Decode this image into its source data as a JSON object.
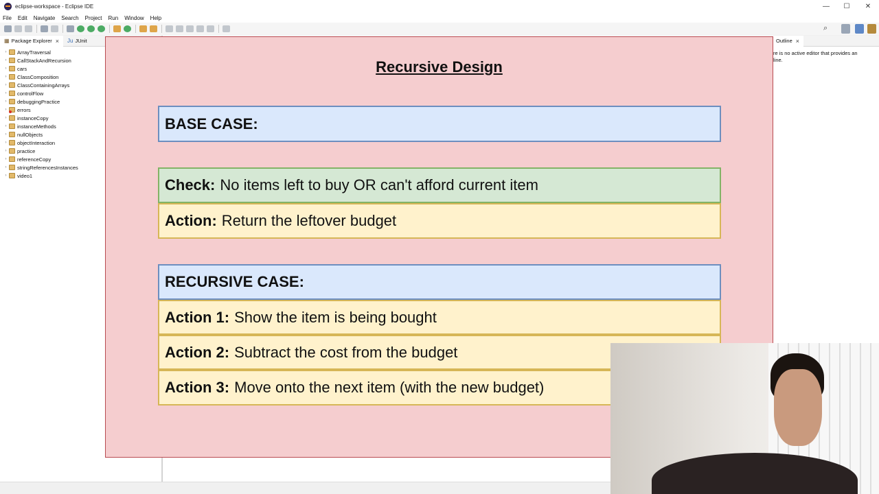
{
  "window": {
    "title": "eclipse-workspace - Eclipse IDE",
    "minimize": "—",
    "maximize": "☐",
    "close": "✕"
  },
  "menu": [
    "File",
    "Edit",
    "Navigate",
    "Search",
    "Project",
    "Run",
    "Window",
    "Help"
  ],
  "package_explorer": {
    "tab_label": "Package Explorer",
    "junit_tab_label": "JUnit",
    "projects": [
      {
        "name": "ArrayTraversal",
        "error": false
      },
      {
        "name": "CallStackAndRecursion",
        "error": false
      },
      {
        "name": "cars",
        "error": false
      },
      {
        "name": "ClassComposition",
        "error": false
      },
      {
        "name": "ClassContainingArrays",
        "error": false
      },
      {
        "name": "controlFlow",
        "error": false
      },
      {
        "name": "debuggingPractice",
        "error": false
      },
      {
        "name": "errors",
        "error": true
      },
      {
        "name": "instanceCopy",
        "error": false
      },
      {
        "name": "instanceMethods",
        "error": false
      },
      {
        "name": "nullObjects",
        "error": false
      },
      {
        "name": "objectInteraction",
        "error": false
      },
      {
        "name": "practice",
        "error": false
      },
      {
        "name": "referenceCopy",
        "error": false
      },
      {
        "name": "stringReferencesInstances",
        "error": false
      },
      {
        "name": "video1",
        "error": false
      }
    ]
  },
  "outline": {
    "tab_label": "Outline",
    "message_line1": "re is no active editor that provides an",
    "message_line2": "line."
  },
  "slide": {
    "title": "Recursive Design",
    "base_case": {
      "header": "BASE CASE:",
      "check_label": "Check:",
      "check_text": "No items left to buy OR can't afford current item",
      "action_label": "Action:",
      "action_text": "Return the leftover budget"
    },
    "recursive_case": {
      "header": "RECURSIVE CASE:",
      "actions": [
        {
          "label": "Action 1:",
          "text": "Show the item is being bought"
        },
        {
          "label": "Action 2:",
          "text": "Subtract the cost from the budget"
        },
        {
          "label": "Action 3:",
          "text": "Move onto the next item (with the new budget)"
        }
      ]
    }
  },
  "colors": {
    "slide_bg": "#f5cdcf",
    "blue_box": "#dae8fc",
    "green_box": "#d5e8d4",
    "yellow_box": "#fff2cc"
  }
}
